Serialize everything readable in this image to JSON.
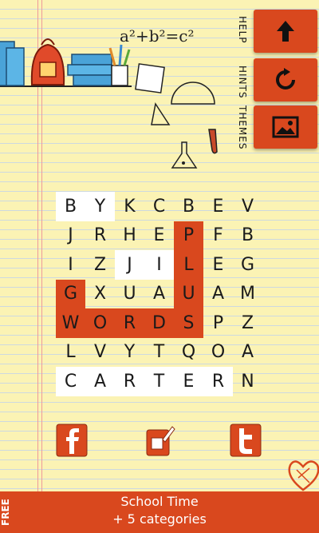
{
  "top_buttons": [
    {
      "label": "HELP",
      "icon": "arrow-up-icon"
    },
    {
      "label": "HINTS",
      "icon": "refresh-icon"
    },
    {
      "label": "THEMES",
      "icon": "picture-icon"
    }
  ],
  "formula": "a²+b²=c²",
  "grid": {
    "rows": [
      [
        "B",
        "Y",
        "K",
        "C",
        "B",
        "E",
        "V"
      ],
      [
        "J",
        "R",
        "H",
        "E",
        "P",
        "F",
        "B"
      ],
      [
        "I",
        "Z",
        "J",
        "I",
        "L",
        "E",
        "G"
      ],
      [
        "G",
        "X",
        "U",
        "A",
        "U",
        "A",
        "M"
      ],
      [
        "W",
        "O",
        "R",
        "D",
        "S",
        "P",
        "Z"
      ],
      [
        "L",
        "V",
        "Y",
        "T",
        "Q",
        "O",
        "A"
      ],
      [
        "C",
        "A",
        "R",
        "T",
        "E",
        "R",
        "N"
      ]
    ],
    "found_words": [
      "PLUS",
      "WORDS"
    ],
    "highlight_words": [
      "BY",
      "JI",
      "CARTER"
    ]
  },
  "social": [
    {
      "name": "facebook",
      "icon": "facebook-icon"
    },
    {
      "name": "share",
      "icon": "share-icon"
    },
    {
      "name": "twitter",
      "icon": "twitter-icon"
    }
  ],
  "footer": {
    "badge": "FREE",
    "line1": "School Time",
    "line2": "+ 5 categories"
  },
  "colors": {
    "accent": "#d9481e",
    "paper": "#fbf3b4",
    "line": "#cdd9e0",
    "margin": "#ef9a9a"
  }
}
